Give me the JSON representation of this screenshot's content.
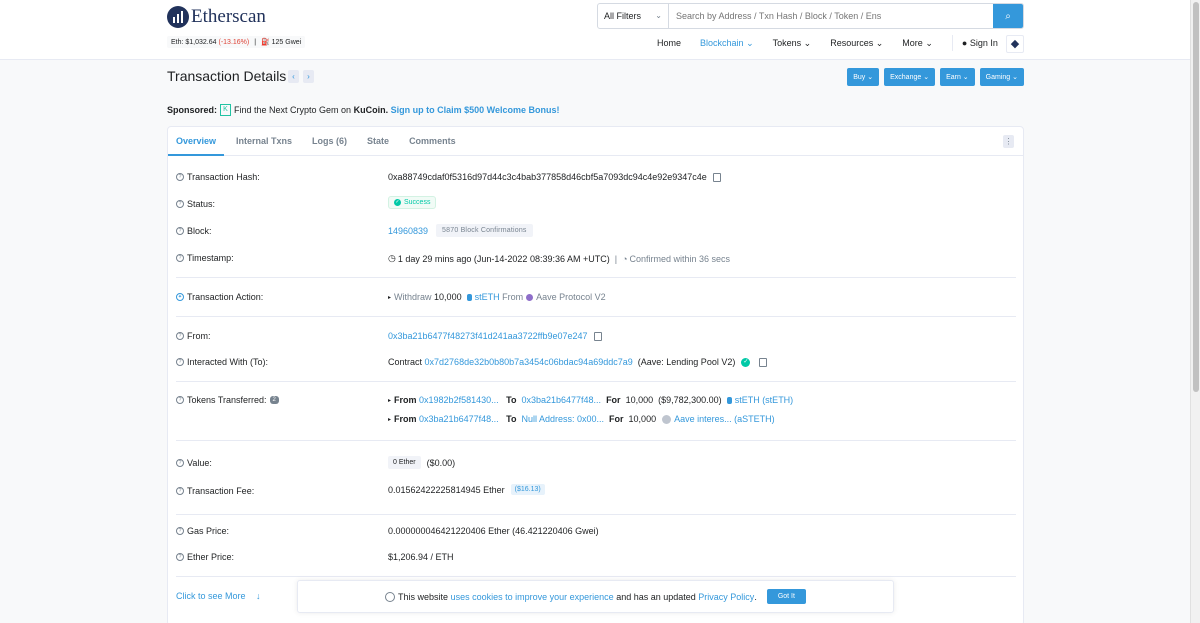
{
  "header": {
    "logo_text": "Etherscan",
    "eth_price_label": "Eth: $1,032.64",
    "eth_change": "(-13.16%)",
    "separator": "|",
    "gas": "125 Gwei",
    "search": {
      "filter_label": "All Filters",
      "placeholder": "Search by Address / Txn Hash / Block / Token / Ens"
    },
    "nav": {
      "home": "Home",
      "blockchain": "Blockchain",
      "tokens": "Tokens",
      "resources": "Resources",
      "more": "More",
      "sign_in": "Sign In"
    }
  },
  "page": {
    "title": "Transaction Details",
    "buttons": {
      "buy": "Buy",
      "exchange": "Exchange",
      "earn": "Earn",
      "gaming": "Gaming"
    },
    "sponsored": {
      "label": "Sponsored:",
      "text": "Find the Next Crypto Gem on",
      "brand": "KuCoin.",
      "cta": "Sign up to Claim $500 Welcome Bonus!"
    }
  },
  "tabs": [
    {
      "label": "Overview",
      "active": true
    },
    {
      "label": "Internal Txns"
    },
    {
      "label": "Logs (6)"
    },
    {
      "label": "State"
    },
    {
      "label": "Comments"
    }
  ],
  "details": {
    "tx_hash_label": "Transaction Hash:",
    "tx_hash": "0xa88749cdaf0f5316d97d44c3c4bab377858d46cbf5a7093dc94c4e92e9347c4e",
    "status_label": "Status:",
    "status": "Success",
    "block_label": "Block:",
    "block": "14960839",
    "confirmations": "5870 Block Confirmations",
    "timestamp_label": "Timestamp:",
    "timestamp": "1 day 29 mins ago (Jun-14-2022 08:39:36 AM +UTC)",
    "timestamp_sep": "|",
    "confirmed": "Confirmed within 36 secs",
    "action_label": "Transaction Action:",
    "action_withdraw": "Withdraw",
    "action_amount": "10,000",
    "action_token": "stETH",
    "action_from": "From",
    "action_protocol": "Aave Protocol V2",
    "from_label": "From:",
    "from": "0x3ba21b6477f48273f41d241aa3722ffb9e07e247",
    "to_label": "Interacted With (To):",
    "to_prefix": "Contract",
    "to_address": "0x7d2768de32b0b80b7a3454c06bdac94a69ddc7a9",
    "to_name": "(Aave: Lending Pool V2)",
    "tokens_label": "Tokens Transferred:",
    "tokens_count": "2",
    "transfers": [
      {
        "from_word": "From",
        "from": "0x1982b2f581430...",
        "to_word": "To",
        "to": "0x3ba21b6477f48...",
        "for_word": "For",
        "amount": "10,000",
        "usd": "($9,782,300.00)",
        "token": "stETH (stETH)"
      },
      {
        "from_word": "From",
        "from": "0x3ba21b6477f48...",
        "to_word": "To",
        "to": "Null Address: 0x00...",
        "for_word": "For",
        "amount": "10,000",
        "usd": "",
        "token": "Aave interes... (aSTETH)"
      }
    ],
    "value_label": "Value:",
    "value": "0 Ether",
    "value_usd": "($0.00)",
    "fee_label": "Transaction Fee:",
    "fee": "0.01562422225814945 Ether",
    "fee_usd": "($16.13)",
    "gas_price_label": "Gas Price:",
    "gas_price": "0.000000046421220406 Ether (46.421220406 Gwei)",
    "ether_price_label": "Ether Price:",
    "ether_price": "$1,206.94 / ETH",
    "see_more": "Click to see More"
  },
  "cookie": {
    "text1": "This website",
    "link1": "uses cookies to improve your experience",
    "text2": "and has an updated",
    "link2": "Privacy Policy",
    "text3": ".",
    "button": "Got It"
  },
  "colors": {
    "accent": "#3498db",
    "success": "#00c9a7",
    "negative": "#de4437",
    "brand_dark": "#21325b"
  }
}
